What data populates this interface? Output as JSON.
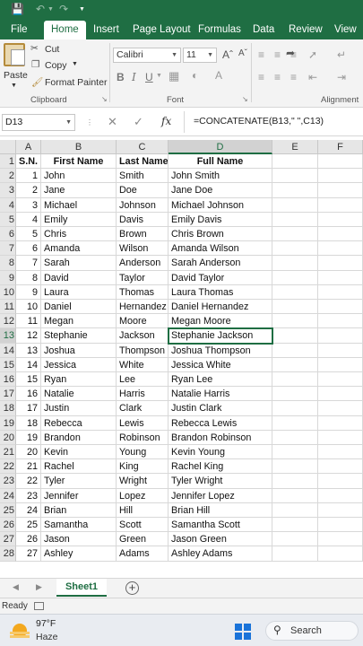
{
  "ribbon_tabs": [
    "File",
    "Home",
    "Insert",
    "Page Layout",
    "Formulas",
    "Data",
    "Review",
    "View"
  ],
  "clipboard": {
    "paste": "Paste",
    "cut": "Cut",
    "copy": "Copy",
    "format_painter": "Format Painter",
    "group_label": "Clipboard"
  },
  "font": {
    "name": "Calibri",
    "size": "11",
    "group_label": "Font"
  },
  "alignment": {
    "group_label": "Alignment"
  },
  "formula_bar": {
    "name_box": "D13",
    "formula": "=CONCATENATE(B13,\" \",C13)"
  },
  "columns": [
    "A",
    "B",
    "C",
    "D",
    "E",
    "F"
  ],
  "headers": {
    "sn": "S.N.",
    "first": "First Name",
    "last": "Last Name",
    "full": "Full Name"
  },
  "rows": [
    {
      "sn": "1",
      "first": "John",
      "last": "Smith",
      "full": "John Smith"
    },
    {
      "sn": "2",
      "first": "Jane",
      "last": "Doe",
      "full": "Jane Doe"
    },
    {
      "sn": "3",
      "first": "Michael",
      "last": "Johnson",
      "full": "Michael Johnson"
    },
    {
      "sn": "4",
      "first": "Emily",
      "last": "Davis",
      "full": "Emily Davis"
    },
    {
      "sn": "5",
      "first": "Chris",
      "last": "Brown",
      "full": "Chris Brown"
    },
    {
      "sn": "6",
      "first": "Amanda",
      "last": "Wilson",
      "full": "Amanda Wilson"
    },
    {
      "sn": "7",
      "first": "Sarah",
      "last": "Anderson",
      "full": "Sarah Anderson"
    },
    {
      "sn": "8",
      "first": "David",
      "last": "Taylor",
      "full": "David Taylor"
    },
    {
      "sn": "9",
      "first": "Laura",
      "last": "Thomas",
      "full": "Laura Thomas"
    },
    {
      "sn": "10",
      "first": "Daniel",
      "last": "Hernandez",
      "full": "Daniel Hernandez"
    },
    {
      "sn": "11",
      "first": "Megan",
      "last": "Moore",
      "full": "Megan Moore"
    },
    {
      "sn": "12",
      "first": "Stephanie",
      "last": "Jackson",
      "full": "Stephanie Jackson"
    },
    {
      "sn": "13",
      "first": "Joshua",
      "last": "Thompson",
      "full": "Joshua Thompson"
    },
    {
      "sn": "14",
      "first": "Jessica",
      "last": "White",
      "full": "Jessica White"
    },
    {
      "sn": "15",
      "first": "Ryan",
      "last": "Lee",
      "full": "Ryan Lee"
    },
    {
      "sn": "16",
      "first": "Natalie",
      "last": "Harris",
      "full": "Natalie Harris"
    },
    {
      "sn": "17",
      "first": "Justin",
      "last": "Clark",
      "full": "Justin Clark"
    },
    {
      "sn": "18",
      "first": "Rebecca",
      "last": "Lewis",
      "full": "Rebecca Lewis"
    },
    {
      "sn": "19",
      "first": "Brandon",
      "last": "Robinson",
      "full": "Brandon Robinson"
    },
    {
      "sn": "20",
      "first": "Kevin",
      "last": "Young",
      "full": "Kevin Young"
    },
    {
      "sn": "21",
      "first": "Rachel",
      "last": "King",
      "full": "Rachel King"
    },
    {
      "sn": "22",
      "first": "Tyler",
      "last": "Wright",
      "full": "Tyler Wright"
    },
    {
      "sn": "23",
      "first": "Jennifer",
      "last": "Lopez",
      "full": "Jennifer Lopez"
    },
    {
      "sn": "24",
      "first": "Brian",
      "last": "Hill",
      "full": "Brian Hill"
    },
    {
      "sn": "25",
      "first": "Samantha",
      "last": "Scott",
      "full": "Samantha Scott"
    },
    {
      "sn": "26",
      "first": "Jason",
      "last": "Green",
      "full": "Jason Green"
    },
    {
      "sn": "27",
      "first": "Ashley",
      "last": "Adams",
      "full": "Ashley Adams"
    }
  ],
  "active_cell": "D13",
  "sheet_tab": "Sheet1",
  "status": "Ready",
  "weather": {
    "temp": "97°F",
    "condition": "Haze"
  },
  "taskbar_search": "Search",
  "colors": {
    "accent": "#1f6e43",
    "windows_blue": "#1a73d9"
  }
}
